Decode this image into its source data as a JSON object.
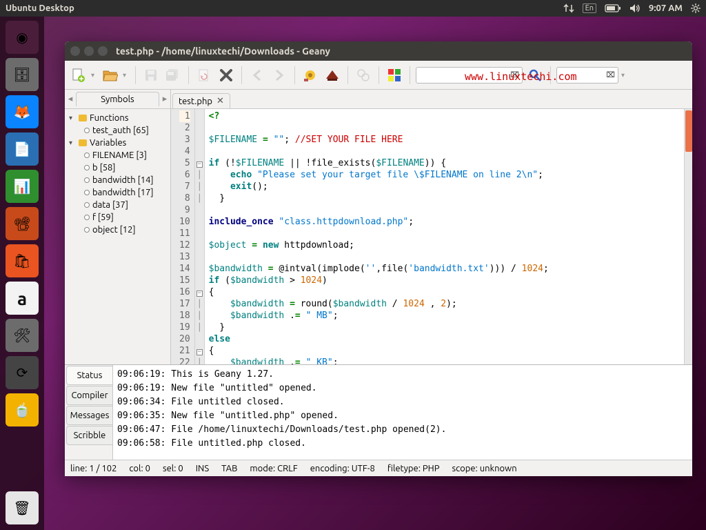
{
  "menubar": {
    "title": "Ubuntu Desktop",
    "time": "9:07 AM",
    "lang": "En"
  },
  "launcher": [
    {
      "name": "dash",
      "bg": "#4a1e3a",
      "glyph": "◉"
    },
    {
      "name": "files",
      "bg": "#6c6c6c",
      "glyph": "🗄"
    },
    {
      "name": "firefox",
      "bg": "#0a84ff",
      "glyph": "🦊"
    },
    {
      "name": "writer",
      "bg": "#2a6fb3",
      "glyph": "📄"
    },
    {
      "name": "calc",
      "bg": "#2f8f2f",
      "glyph": "📊"
    },
    {
      "name": "impress",
      "bg": "#c84a1a",
      "glyph": "📽"
    },
    {
      "name": "software",
      "bg": "#e95420",
      "glyph": "🛍"
    },
    {
      "name": "amazon",
      "bg": "#f3f3f3",
      "glyph": "a"
    },
    {
      "name": "settings",
      "bg": "#6c6c6c",
      "glyph": "🛠"
    },
    {
      "name": "updater",
      "bg": "#444",
      "glyph": "⟳"
    },
    {
      "name": "thunderbird",
      "bg": "#f3b200",
      "glyph": "🍵"
    }
  ],
  "launcher_trash": {
    "name": "trash",
    "bg": "#e6e6e6",
    "glyph": "🗑"
  },
  "window": {
    "title": "test.php - /home/linuxtechi/Downloads - Geany",
    "watermark": "www.linuxtechi.com"
  },
  "sidebar": {
    "tab_label": "Symbols",
    "groups": [
      {
        "label": "Functions",
        "items": [
          {
            "label": "test_auth [65]"
          }
        ]
      },
      {
        "label": "Variables",
        "items": [
          {
            "label": "FILENAME [3]"
          },
          {
            "label": "b [58]"
          },
          {
            "label": "bandwidth [14]"
          },
          {
            "label": "bandwidth [17]"
          },
          {
            "label": "data [37]"
          },
          {
            "label": "f [59]"
          },
          {
            "label": "object [12]"
          }
        ]
      }
    ]
  },
  "editor": {
    "tab_label": "test.php",
    "line_count": 22,
    "folds": {
      "5": "⊟",
      "16": "⊟",
      "21": "⊟"
    },
    "code_html": [
      "<span class='op'>&lt;?</span>",
      "",
      "<span class='var'>$FILENAME</span> <span class='op'>=</span> <span class='str'>\"\"</span>; <span class='cmt'>//SET YOUR FILE HERE</span>",
      "",
      "<span class='kw'>if</span> (!<span class='var'>$FILENAME</span> || !<span class='fn'>file_exists</span>(<span class='var'>$FILENAME</span>)) {",
      "    <span class='kw'>echo</span> <span class='str'>\"Please set your target file \\$FILENAME on line 2\\n\"</span>;",
      "    <span class='kw'>exit</span>();",
      "  }",
      "",
      "<span class='kw2'>include_once</span> <span class='str'>\"class.httpdownload.php\"</span>;",
      "",
      "<span class='var'>$object</span> <span class='op'>=</span> <span class='kw'>new</span> httpdownload;",
      "",
      "<span class='var'>$bandwidth</span> <span class='op'>=</span> @<span class='fn'>intval</span>(<span class='fn'>implode</span>(<span class='str'>''</span>,<span class='fn'>file</span>(<span class='str'>'bandwidth.txt'</span>))) / <span class='num'>1024</span>;",
      "<span class='kw'>if</span> (<span class='var'>$bandwidth</span> &gt; <span class='num'>1024</span>)",
      "{",
      "    <span class='var'>$bandwidth</span> <span class='op'>=</span> <span class='fn'>round</span>(<span class='var'>$bandwidth</span> / <span class='num'>1024</span> , <span class='num'>2</span>);",
      "    <span class='var'>$bandwidth</span> .<span class='op'>=</span> <span class='str'>\" MB\"</span>;",
      "  }",
      "<span class='kw'>else</span>",
      "{",
      "    <span class='var'>$bandwidth</span> .<span class='op'>=</span> <span class='str'>\" KB\"</span>;"
    ]
  },
  "bottom": {
    "tabs": [
      "Status",
      "Compiler",
      "Messages",
      "Scribble"
    ],
    "active_tab": 0,
    "messages": [
      "09:06:19: This is Geany 1.27.",
      "09:06:19: New file \"untitled\" opened.",
      "09:06:34: File untitled closed.",
      "09:06:35: New file \"untitled.php\" opened.",
      "09:06:47: File /home/linuxtechi/Downloads/test.php opened(2).",
      "09:06:58: File untitled.php closed."
    ]
  },
  "status": {
    "line": "line: 1 / 102",
    "col": "col: 0",
    "sel": "sel: 0",
    "ins": "INS",
    "tab": "TAB",
    "mode": "mode: CRLF",
    "enc": "encoding: UTF-8",
    "filetype": "filetype: PHP",
    "scope": "scope: unknown"
  }
}
